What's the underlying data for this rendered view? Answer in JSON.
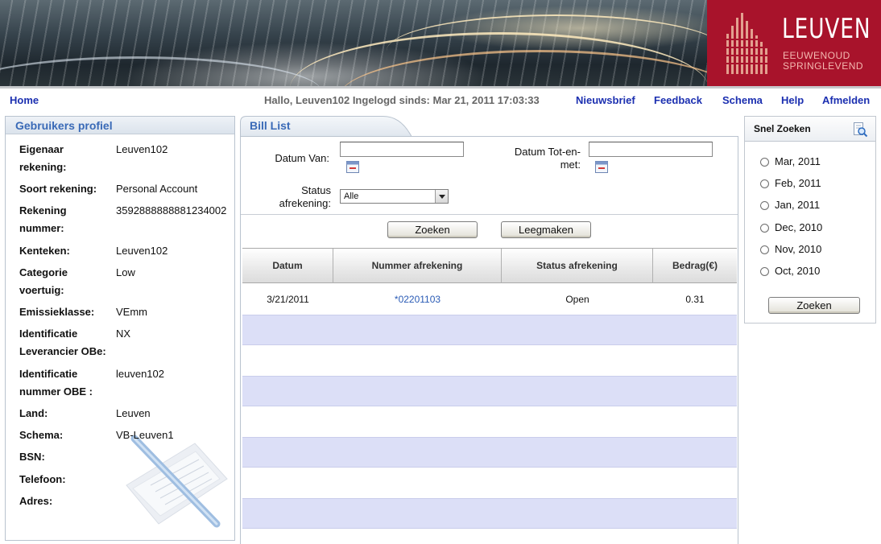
{
  "banner": {
    "logo_title": "LEUVEN",
    "logo_sub1": "EEUWENOUD",
    "logo_sub2": "SPRINGLEVEND"
  },
  "nav": {
    "home": "Home",
    "greeting": "Hallo, Leuven102 Ingelogd sinds: Mar 21, 2011 17:03:33",
    "links": [
      "Nieuwsbrief",
      "Feedback",
      "Schema",
      "Help",
      "Afmelden"
    ]
  },
  "profile": {
    "title": "Gebruikers profiel",
    "rows": [
      {
        "label_line1": "Eigenaar",
        "label_line2": "rekening:",
        "value": "Leuven102"
      },
      {
        "label_line1": "Soort rekening:",
        "label_line2": "",
        "value": "Personal Account"
      },
      {
        "label_line1": "Rekening",
        "label_line2": "nummer:",
        "value": "3592888888881234002"
      },
      {
        "label_line1": "Kenteken:",
        "label_line2": "",
        "value": "Leuven102"
      },
      {
        "label_line1": "Categorie",
        "label_line2": "voertuig:",
        "value": "Low"
      },
      {
        "label_line1": "Emissieklasse:",
        "label_line2": "",
        "value": "VEmm"
      },
      {
        "label_line1": "Identificatie",
        "label_line2": "Leverancier OBe:",
        "value": "NX"
      },
      {
        "label_line1": "Identificatie",
        "label_line2": "nummer OBE :",
        "value": "leuven102"
      },
      {
        "label_line1": "Land:",
        "label_line2": "",
        "value": "Leuven"
      },
      {
        "label_line1": "Schema:",
        "label_line2": "",
        "value": "VB-Leuven1"
      },
      {
        "label_line1": "BSN:",
        "label_line2": "",
        "value": ""
      },
      {
        "label_line1": "Telefoon:",
        "label_line2": "",
        "value": ""
      },
      {
        "label_line1": "Adres:",
        "label_line2": "",
        "value": ""
      }
    ]
  },
  "bill_list": {
    "title": "Bill List",
    "datum_van_label": "Datum Van:",
    "datum_van_value": "",
    "datum_tot_label_line1": "Datum Tot-en-",
    "datum_tot_label_line2": "met:",
    "datum_tot_value": "",
    "status_label_line1": "Status",
    "status_label_line2": "afrekening:",
    "status_selected": "Alle",
    "search_button": "Zoeken",
    "clear_button": "Leegmaken",
    "columns": [
      "Datum",
      "Nummer afrekening",
      "Status afrekening",
      "Bedrag(€)"
    ],
    "rows": [
      {
        "datum": "3/21/2011",
        "nummer": "*02201103",
        "status": "Open",
        "bedrag": "0.31"
      }
    ]
  },
  "snel_zoeken": {
    "title": "Snel Zoeken",
    "options": [
      "Mar, 2011",
      "Feb, 2011",
      "Jan, 2011",
      "Dec, 2010",
      "Nov, 2010",
      "Oct, 2010"
    ],
    "button": "Zoeken"
  },
  "colors": {
    "brand_red": "#a8132b",
    "link_blue": "#1b2fb0",
    "panel_title_blue": "#3a6ab7",
    "row_stripe": "#dcdff7"
  }
}
